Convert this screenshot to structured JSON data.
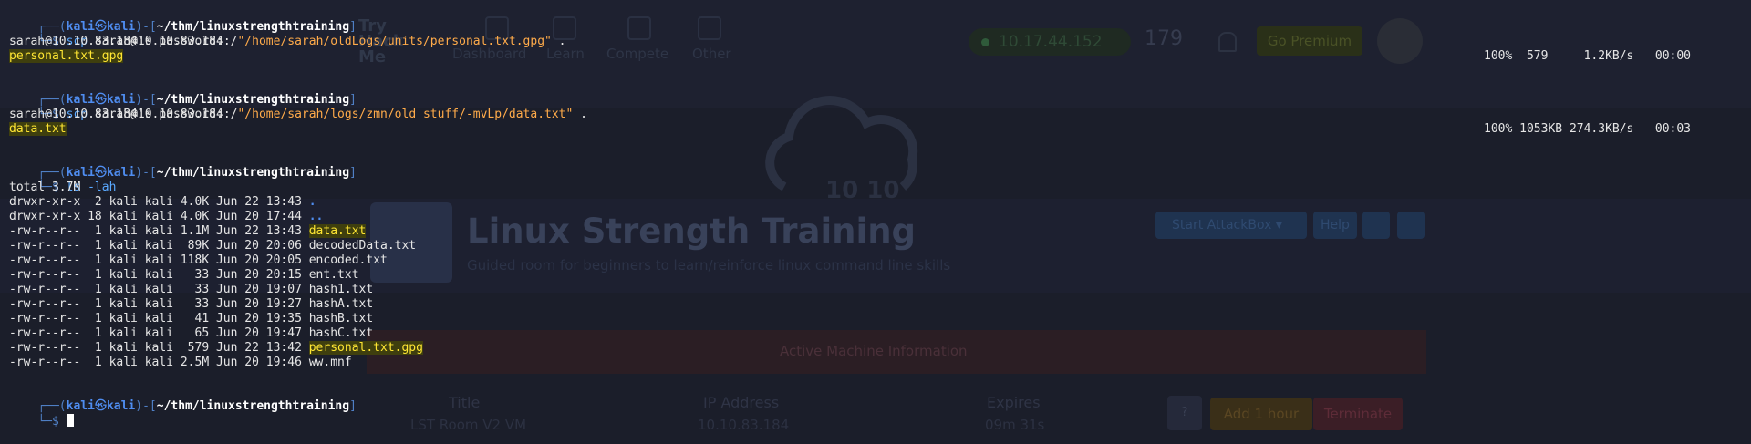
{
  "background_page": {
    "logo": "Try\nHack\nMe",
    "nav": [
      "Dashboard",
      "Learn",
      "Compete",
      "Other"
    ],
    "ip_pill": "10.17.44.152",
    "points": "179",
    "premium_button": "Go Premium",
    "cloud_text": "10 10",
    "room_title": "Linux Strength Training",
    "room_subtitle": "Guided room for beginners to learn/reinforce linux command line skills",
    "start_attackbox": "Start AttackBox",
    "help_button": "Help",
    "machine_header": "Active Machine Information",
    "machine_columns": [
      "Title",
      "IP Address",
      "Expires"
    ],
    "machine_values": [
      "LST Room V2 VM",
      "10.10.83.184",
      "09m 31s"
    ],
    "question_button": "?",
    "add_hour_button": "Add 1 hour",
    "terminate_button": "Terminate"
  },
  "prompt": {
    "top": "┌──(",
    "user": "kali",
    "skull": "㉿",
    "host": "kali",
    "close": ")-[",
    "cwd": "~/thm/linuxstrengthtraining",
    "end": "]",
    "bottom": "└─$"
  },
  "session": {
    "cmd1": {
      "name": "scp",
      "arg": "sarah@10.10.83.184:/",
      "quoted": "\"/home/sarah/oldLogs/units/personal.txt.gpg\"",
      "dest": " ."
    },
    "password_prompt_1": "sarah@10.10.83.184's password:",
    "transfer_1": {
      "file": "personal.txt.gpg",
      "percent": "100%",
      "size": "579",
      "rate": "1.2KB/s",
      "time": "00:00"
    },
    "cmd2": {
      "name": "scp",
      "arg": "sarah@10.10.83.184:/",
      "quoted": "\"/home/sarah/logs/zmn/old stuff/-mvLp/data.txt\"",
      "dest": " ."
    },
    "password_prompt_2": "sarah@10.10.83.184's password:",
    "transfer_2": {
      "file": "data.txt",
      "percent": "100%",
      "size": "1053KB",
      "rate": "274.3KB/s",
      "time": "00:03"
    },
    "cmd3": {
      "name": "ls",
      "arg": "-lah"
    },
    "ls_total": "total 3.7M",
    "ls_rows": [
      {
        "perm": "drwxr-xr-x  2 kali kali 4.0K Jun 22 13:43 ",
        "name": ".",
        "type": "dir"
      },
      {
        "perm": "drwxr-xr-x 18 kali kali 4.0K Jun 20 17:44 ",
        "name": "..",
        "type": "dir"
      },
      {
        "perm": "-rw-r--r--  1 kali kali 1.1M Jun 22 13:43 ",
        "name": "data.txt",
        "type": "highlight"
      },
      {
        "perm": "-rw-r--r--  1 kali kali  89K Jun 20 20:06 ",
        "name": "decodedData.txt",
        "type": "file"
      },
      {
        "perm": "-rw-r--r--  1 kali kali 118K Jun 20 20:05 ",
        "name": "encoded.txt",
        "type": "file"
      },
      {
        "perm": "-rw-r--r--  1 kali kali   33 Jun 20 20:15 ",
        "name": "ent.txt",
        "type": "file"
      },
      {
        "perm": "-rw-r--r--  1 kali kali   33 Jun 20 19:07 ",
        "name": "hash1.txt",
        "type": "file"
      },
      {
        "perm": "-rw-r--r--  1 kali kali   33 Jun 20 19:27 ",
        "name": "hashA.txt",
        "type": "file"
      },
      {
        "perm": "-rw-r--r--  1 kali kali   41 Jun 20 19:35 ",
        "name": "hashB.txt",
        "type": "file"
      },
      {
        "perm": "-rw-r--r--  1 kali kali   65 Jun 20 19:47 ",
        "name": "hashC.txt",
        "type": "file"
      },
      {
        "perm": "-rw-r--r--  1 kali kali  579 Jun 22 13:42 ",
        "name": "personal.txt.gpg",
        "type": "highlight"
      },
      {
        "perm": "-rw-r--r--  1 kali kali 2.5M Jun 20 19:46 ",
        "name": "ww.mnf",
        "type": "file"
      }
    ]
  }
}
